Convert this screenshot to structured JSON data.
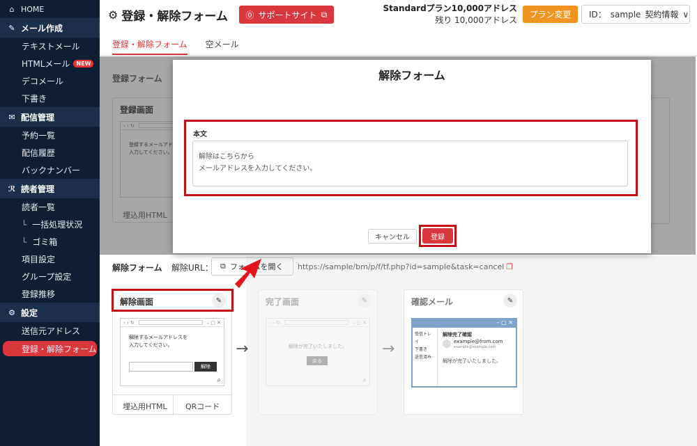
{
  "sidebar": {
    "home": "HOME",
    "sections": [
      {
        "label": "メール作成",
        "items": [
          "テキストメール",
          "HTMLメール",
          "デコメール",
          "下書き"
        ]
      },
      {
        "label": "配信管理",
        "items": [
          "予約一覧",
          "配信履歴",
          "バックナンバー"
        ]
      },
      {
        "label": "読者管理",
        "items": [
          "読者一覧",
          "一括処理状況",
          "ゴミ箱",
          "項目設定",
          "グループ設定",
          "登録推移"
        ]
      },
      {
        "label": "設定",
        "items": [
          "送信元アドレス",
          "登録・解除フォーム"
        ]
      }
    ],
    "new_badge": "NEW"
  },
  "header": {
    "title": "登録・解除フォーム",
    "support": "サポートサイト",
    "plan_line1": "Standardプラン10,000アドレス",
    "plan_line2": "残り 10,000アドレス",
    "plan_change": "プラン変更",
    "id_label": "ID：",
    "id_value": "sample",
    "contract": "契約情報"
  },
  "tabs": [
    "登録・解除フォーム",
    "空メール"
  ],
  "register": {
    "section": "登録フォーム",
    "card_title": "登録画面",
    "mock_text_1": "登録するメールアドレ",
    "mock_text_2": "入力してください。",
    "embed": "埋込用HTML"
  },
  "unsubscribe": {
    "section": "解除フォーム",
    "url_label": "解除URL：",
    "open_btn": "フォームを開く",
    "url": "https://sample/bm/p/f/tf.php?id=sample&task=cancel",
    "cards": {
      "cancel": {
        "title": "解除画面",
        "text1": "解除するメールアドレスを",
        "text2": "入力してください。",
        "button": "解除",
        "embed": "埋込用HTML",
        "qr": "QRコード"
      },
      "done": {
        "title": "完了画面",
        "text": "解除が完了いたしました。",
        "button": "戻る"
      },
      "mail": {
        "title": "確認メール",
        "inbox": "受信トレイ",
        "draft": "下書き",
        "sent": "送信済み",
        "subject": "解除完了確認",
        "from": "example@from.com",
        "to": "example@example.com",
        "body": "解除が完了いたしました。"
      }
    }
  },
  "modal": {
    "title": "解除フォーム",
    "body_label": "本文",
    "body_line1": "解除はこちらから",
    "body_line2": "メールアドレスを入力してください。",
    "cancel": "キャンセル",
    "submit": "登録"
  }
}
